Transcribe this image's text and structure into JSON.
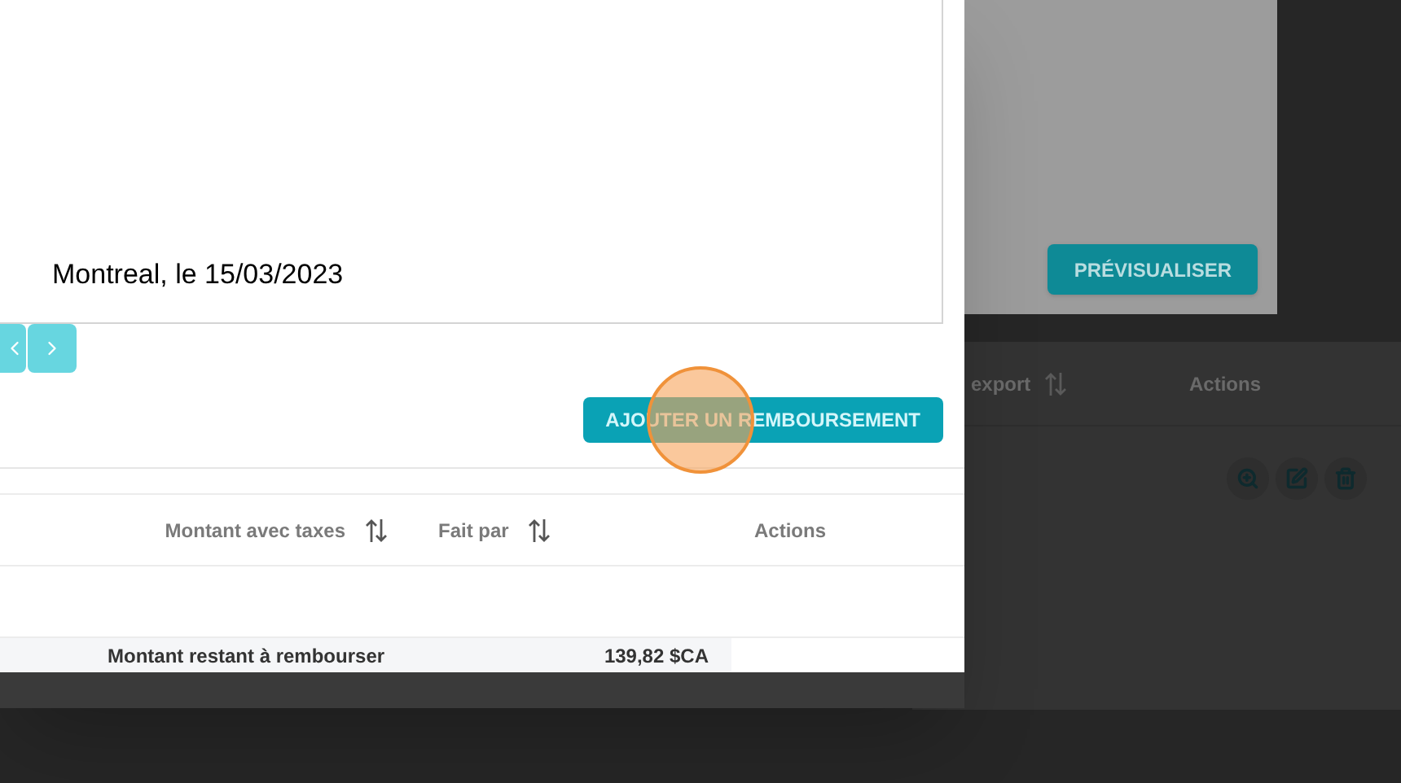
{
  "background": {
    "preview_button": "PRÉVISUALISER",
    "table": {
      "columns": [
        {
          "label": "export",
          "sortable": true
        },
        {
          "label": "Actions",
          "sortable": false
        }
      ]
    }
  },
  "modal": {
    "document": {
      "text": "Montreal, le 15/03/2023"
    },
    "add_button": "AJOUTER UN REMBOURSEMENT",
    "table": {
      "columns": [
        {
          "label": "Montant avec taxes",
          "sortable": true
        },
        {
          "label": "Fait par",
          "sortable": true
        },
        {
          "label": "Actions",
          "sortable": false
        }
      ],
      "summary": {
        "label": "Montant restant à rembourser",
        "value": "139,82 $CA"
      }
    }
  }
}
